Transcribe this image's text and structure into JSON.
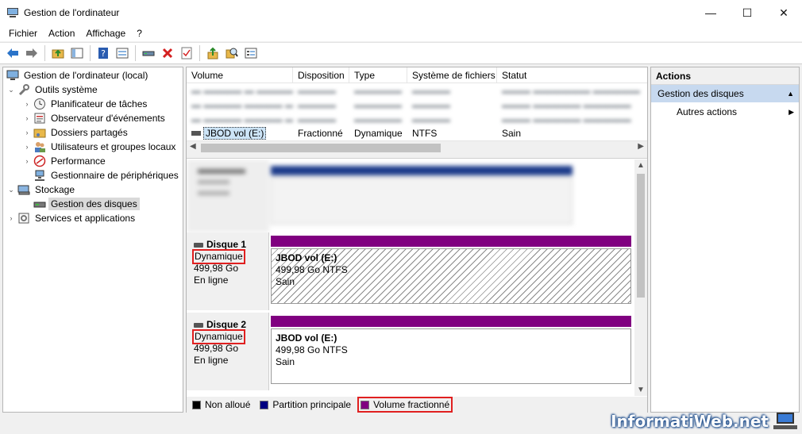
{
  "window": {
    "title": "Gestion de l'ordinateur",
    "minimize": "—",
    "maximize": "☐",
    "close": "✕"
  },
  "menu": [
    "Fichier",
    "Action",
    "Affichage",
    "?"
  ],
  "toolbar": [
    "back-arrow-icon",
    "forward-arrow-icon",
    "folder-up-icon",
    "show-hide-tree-icon",
    "help-icon",
    "properties-icon",
    "connect-icon",
    "delete-icon",
    "check-icon",
    "export-icon",
    "search-icon",
    "details-icon"
  ],
  "tree": {
    "items": [
      {
        "label": "Gestion de l'ordinateur (local)",
        "level": 0,
        "expander": ""
      },
      {
        "label": "Outils système",
        "level": 1,
        "expander": "⌄"
      },
      {
        "label": "Planificateur de tâches",
        "level": 2,
        "expander": "›"
      },
      {
        "label": "Observateur d'événements",
        "level": 2,
        "expander": "›"
      },
      {
        "label": "Dossiers partagés",
        "level": 2,
        "expander": "›"
      },
      {
        "label": "Utilisateurs et groupes locaux",
        "level": 2,
        "expander": "›"
      },
      {
        "label": "Performance",
        "level": 2,
        "expander": "›"
      },
      {
        "label": "Gestionnaire de périphériques",
        "level": 2,
        "expander": ""
      },
      {
        "label": "Stockage",
        "level": 1,
        "expander": "⌄"
      },
      {
        "label": "Gestion des disques",
        "level": 2,
        "expander": "",
        "selected": true
      },
      {
        "label": "Services et applications",
        "level": 1,
        "expander": "›"
      }
    ]
  },
  "volumes": {
    "headers": [
      "Volume",
      "Disposition",
      "Type",
      "Système de fichiers",
      "Statut"
    ],
    "rows": [
      {
        "volume": "JBOD vol (E:)",
        "disposition": "Fractionné",
        "type": "Dynamique",
        "fs": "NTFS",
        "status": "Sain"
      }
    ]
  },
  "disks": [
    {
      "name": "Disque 1",
      "type": "Dynamique",
      "size": "499,98 Go",
      "state": "En ligne",
      "partition": {
        "title": "JBOD vol  (E:)",
        "detail": "499,98 Go NTFS",
        "status": "Sain"
      }
    },
    {
      "name": "Disque 2",
      "type": "Dynamique",
      "size": "499,98 Go",
      "state": "En ligne",
      "partition": {
        "title": "JBOD vol  (E:)",
        "detail": "499,98 Go NTFS",
        "status": "Sain"
      }
    }
  ],
  "legend": [
    {
      "label": "Non alloué",
      "color": "#000000"
    },
    {
      "label": "Partition principale",
      "color": "#000080"
    },
    {
      "label": "Volume fractionné",
      "color": "#800080"
    }
  ],
  "actions": {
    "title": "Actions",
    "section": "Gestion des disques",
    "item": "Autres actions"
  },
  "watermark": "InformatiWeb.net",
  "colors": {
    "spanned": "#800080",
    "selection": "#c7d9ef",
    "highlight": "#e02020"
  }
}
